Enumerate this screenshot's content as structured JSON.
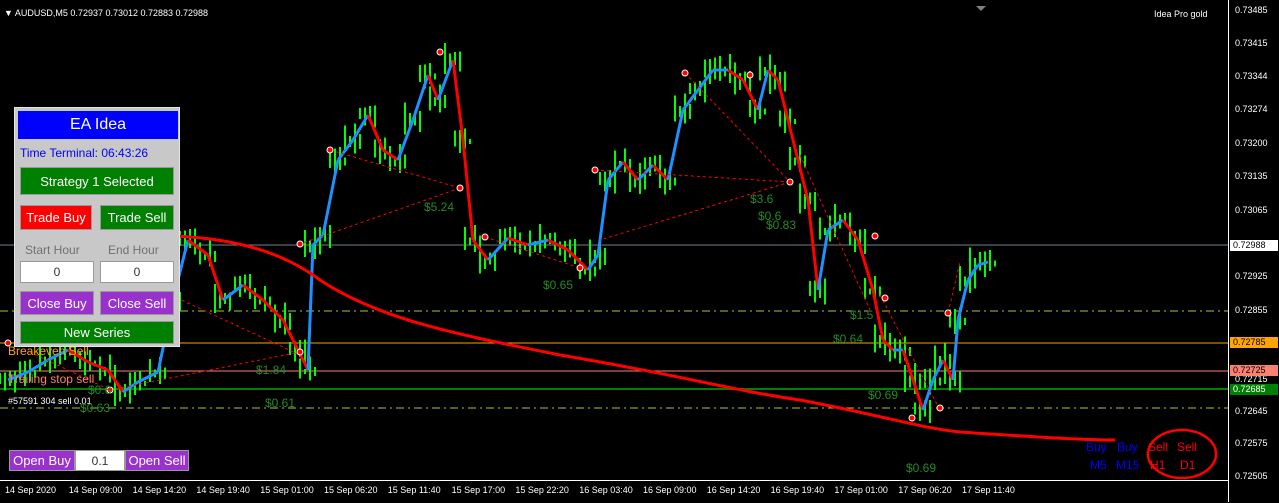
{
  "symbol_info": "AUDUSD,M5  0.72937 0.73012 0.72883 0.72988",
  "indicator_name": "Idea Pro gold",
  "price_axis": {
    "labels": [
      "0.73485",
      "0.73415",
      "0.73344",
      "0.73274",
      "0.73200",
      "0.73135",
      "0.73065",
      "0.72988",
      "0.72925",
      "0.72855",
      "0.72785",
      "0.72725",
      "0.72715",
      "0.72685",
      "0.72645",
      "0.72575",
      "0.72505"
    ],
    "current_price": "0.72988",
    "tag_orange": "0.72785",
    "tag_salmon": "0.72725",
    "tag_green": "0.72685"
  },
  "time_axis": [
    "14 Sep 2020",
    "14 Sep 09:00",
    "14 Sep 14:20",
    "14 Sep 19:40",
    "15 Sep 01:00",
    "15 Sep 06:20",
    "15 Sep 11:40",
    "15 Sep 17:00",
    "15 Sep 22:20",
    "16 Sep 03:40",
    "16 Sep 09:00",
    "16 Sep 14:20",
    "16 Sep 19:40",
    "17 Sep 01:00",
    "17 Sep 06:20",
    "17 Sep 11:40"
  ],
  "panel": {
    "title": "EA Idea",
    "time_terminal": "Time Terminal: 06:43:26",
    "strategy_button": "Strategy 1 Selected",
    "trade_buy": "Trade Buy",
    "trade_sell": "Trade Sell",
    "start_hour_label": "Start Hour",
    "end_hour_label": "End Hour",
    "start_hour_value": "0",
    "end_hour_value": "0",
    "close_buy": "Close Buy",
    "close_sell": "Close Sell",
    "new_series": "New Series"
  },
  "orders": {
    "open_buy": "Open Buy",
    "lot": "0.1",
    "open_sell": "Open Sell"
  },
  "chart_labels": {
    "breakeven": "Breakeven Sell",
    "trailing": "Trailing stop sell",
    "order_info": "#57591 304 sell 0.01",
    "profits": [
      "$5.24",
      "$0.65",
      "$3.6",
      "$0.6",
      "$0.83",
      "$1.5",
      "$0.64",
      "$0.69",
      "$0.69",
      "$1.84",
      "$0.61",
      "$0.6",
      "$0.63",
      "$4.4"
    ]
  },
  "mtf": {
    "row1": [
      "Buy",
      "Buy",
      "Sell",
      "Sell"
    ],
    "row2": [
      "M5",
      "M15",
      "H1",
      "D1"
    ],
    "colors": {
      "buy": "#0000ff",
      "sell": "#ff0000"
    }
  },
  "colors": {
    "uptrend": "#00ff00",
    "line_up": "#1e90ff",
    "line_down": "#ff0000",
    "annotation": "#ff0000",
    "grid_dash": "#9acd32"
  }
}
